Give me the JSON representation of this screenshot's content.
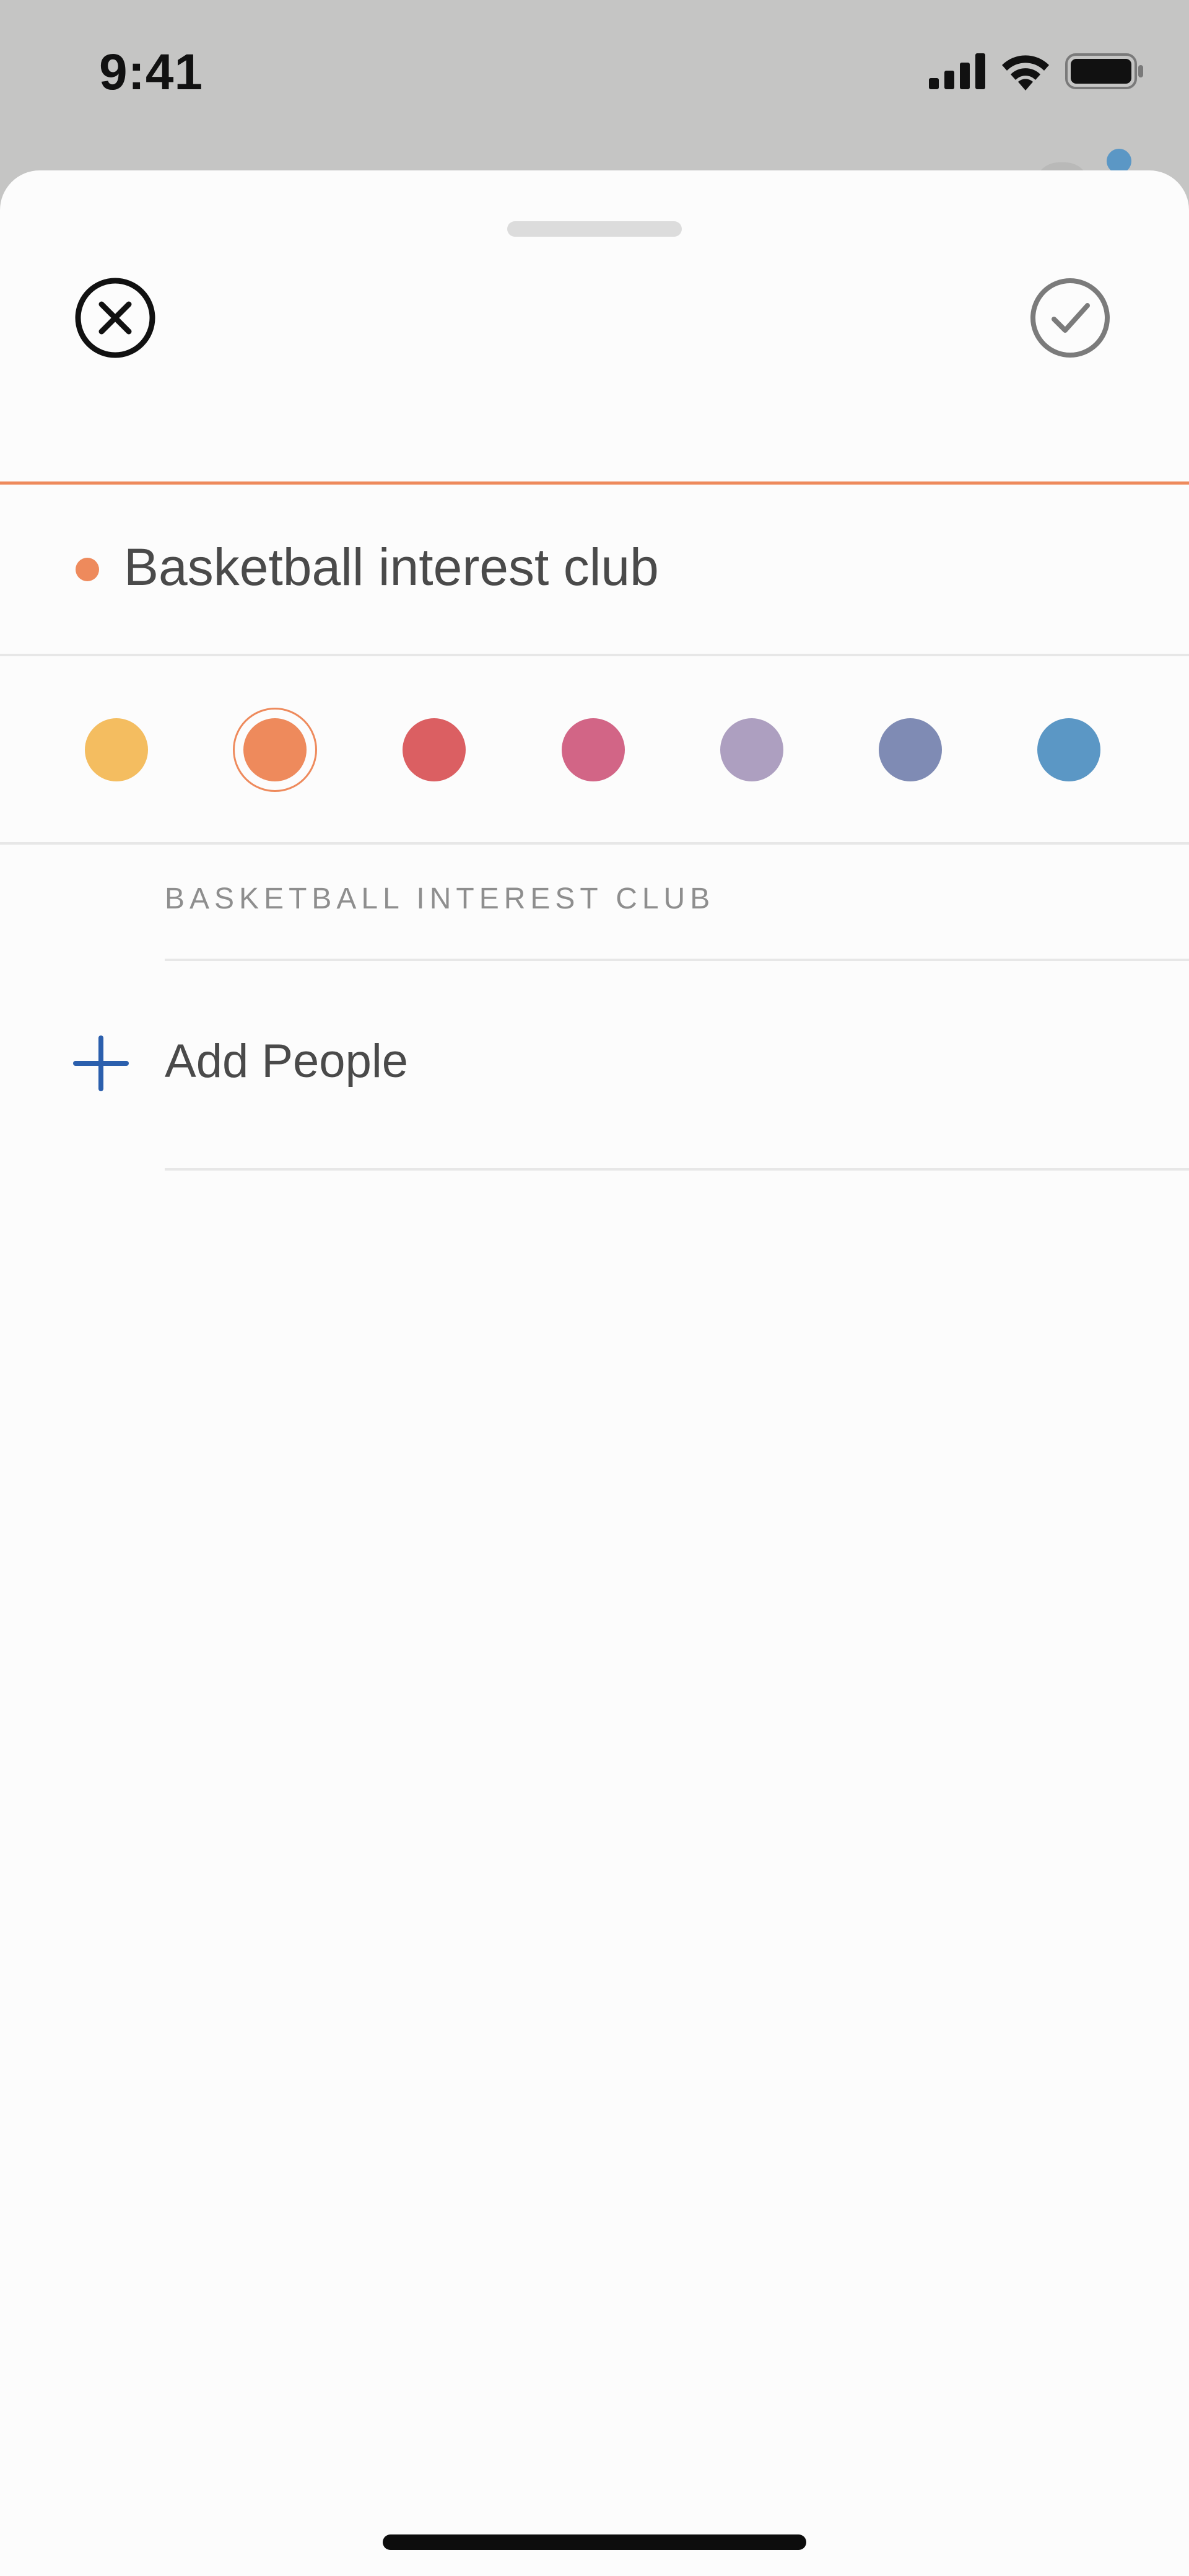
{
  "status_bar": {
    "time": "9:41",
    "icons": [
      "cellular-signal-icon",
      "wifi-icon",
      "battery-icon"
    ]
  },
  "sheet": {
    "close_icon": "close-circle-icon",
    "done_icon": "checkmark-circle-icon",
    "name_field": {
      "value": "Basketball interest club",
      "dot_color": "#ee8a5c"
    },
    "color_swatches": [
      {
        "color": "#f4bd60",
        "selected": false
      },
      {
        "color": "#ee8a5c",
        "selected": true
      },
      {
        "color": "#db5f62",
        "selected": false
      },
      {
        "color": "#d26586",
        "selected": false
      },
      {
        "color": "#ad9fc0",
        "selected": false
      },
      {
        "color": "#7f8bb4",
        "selected": false
      },
      {
        "color": "#5b97c5",
        "selected": false
      }
    ],
    "section_header": "BASKETBALL INTEREST CLUB",
    "add_people": {
      "label": "Add People",
      "icon": "plus-icon",
      "icon_color": "#2b5fad"
    }
  },
  "colors": {
    "accent": "#ee8a5c",
    "sheet_background": "#fcfcfc",
    "backdrop": "#c5c5c4"
  }
}
